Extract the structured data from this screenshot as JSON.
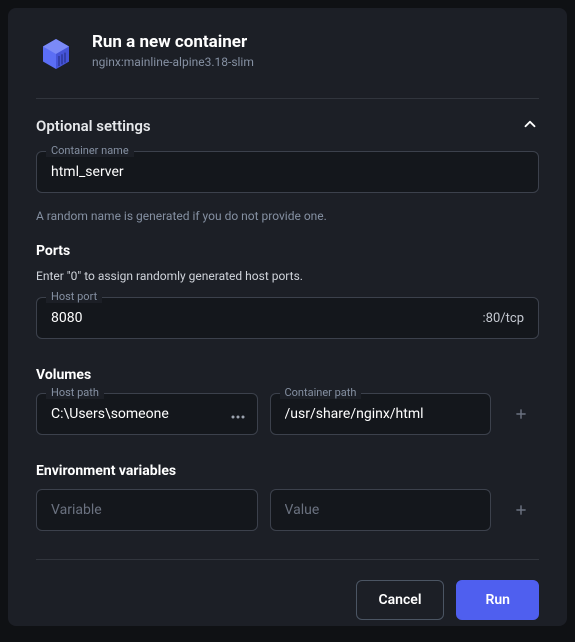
{
  "header": {
    "title": "Run a new container",
    "subtitle": "nginx:mainline-alpine3.18-slim"
  },
  "optional": {
    "section_label": "Optional settings",
    "container_name": {
      "label": "Container name",
      "value": "html_server"
    },
    "helper": "A random name is generated if you do not provide one."
  },
  "ports": {
    "title": "Ports",
    "subtitle": "Enter \"0\" to assign randomly generated host ports.",
    "host_port": {
      "label": "Host port",
      "value": "8080",
      "suffix": ":80/tcp"
    }
  },
  "volumes": {
    "title": "Volumes",
    "host_path": {
      "label": "Host path",
      "value": "C:\\Users\\someone"
    },
    "container_path": {
      "label": "Container path",
      "value": "/usr/share/nginx/html"
    }
  },
  "env": {
    "title": "Environment variables",
    "variable": {
      "placeholder": "Variable",
      "value": ""
    },
    "value": {
      "placeholder": "Value",
      "value": ""
    }
  },
  "footer": {
    "cancel": "Cancel",
    "run": "Run"
  }
}
